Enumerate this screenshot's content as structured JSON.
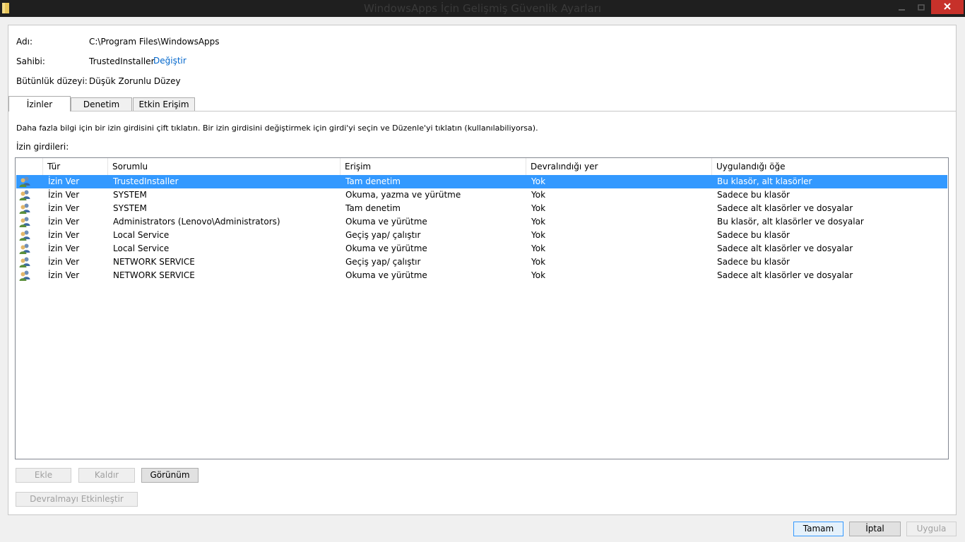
{
  "window": {
    "title": "WindowsApps İçin Gelişmiş Güvenlik Ayarları"
  },
  "info": {
    "name_label": "Adı:",
    "name_value": "C:\\Program Files\\WindowsApps",
    "owner_label": "Sahibi:",
    "owner_value": "TrustedInstaller",
    "owner_change_link": "Değiştir",
    "integrity_label": "Bütünlük düzeyi:",
    "integrity_value": "Düşük Zorunlu Düzey"
  },
  "tabs": [
    {
      "label": "İzinler",
      "active": true
    },
    {
      "label": "Denetim",
      "active": false
    },
    {
      "label": "Etkin Erişim",
      "active": false
    }
  ],
  "description": "Daha fazla bilgi için bir izin girdisini çift tıklatın. Bir izin girdisini değiştirmek için girdi'yi seçin ve Düzenle'yi tıklatın (kullanılabiliyorsa).",
  "list_label": "İzin girdileri:",
  "columns": [
    "Tür",
    "Sorumlu",
    "Erişim",
    "Devralındığı yer",
    "Uygulandığı öğe"
  ],
  "entries": [
    {
      "type": "İzin Ver",
      "principal": "TrustedInstaller",
      "access": "Tam denetim",
      "inherited": "Yok",
      "applies": "Bu klasör, alt klasörler"
    },
    {
      "type": "İzin Ver",
      "principal": "SYSTEM",
      "access": "Okuma, yazma ve yürütme",
      "inherited": "Yok",
      "applies": "Sadece bu klasör"
    },
    {
      "type": "İzin Ver",
      "principal": "SYSTEM",
      "access": "Tam denetim",
      "inherited": "Yok",
      "applies": "Sadece alt klasörler ve dosyalar"
    },
    {
      "type": "İzin Ver",
      "principal": "Administrators (Lenovo\\Administrators)",
      "access": "Okuma ve yürütme",
      "inherited": "Yok",
      "applies": "Bu klasör, alt klasörler ve dosyalar"
    },
    {
      "type": "İzin Ver",
      "principal": "Local Service",
      "access": "Geçiş yap/ çalıştır",
      "inherited": "Yok",
      "applies": "Sadece bu klasör"
    },
    {
      "type": "İzin Ver",
      "principal": "Local Service",
      "access": "Okuma ve yürütme",
      "inherited": "Yok",
      "applies": "Sadece alt klasörler ve dosyalar"
    },
    {
      "type": "İzin Ver",
      "principal": "NETWORK SERVICE",
      "access": "Geçiş yap/ çalıştır",
      "inherited": "Yok",
      "applies": "Sadece bu klasör"
    },
    {
      "type": "İzin Ver",
      "principal": "NETWORK SERVICE",
      "access": "Okuma ve yürütme",
      "inherited": "Yok",
      "applies": "Sadece alt klasörler ve dosyalar"
    }
  ],
  "selected_index": 0,
  "buttons": {
    "add": "Ekle",
    "remove": "Kaldır",
    "view": "Görünüm",
    "enable_inheritance": "Devralmayı Etkinleştir",
    "ok": "Tamam",
    "cancel": "İptal",
    "apply": "Uygula"
  },
  "icons": {
    "window": "folder-icon",
    "entry": "user-group-icon"
  },
  "colors": {
    "selection": "#3399ff",
    "link": "#0066cc",
    "close": "#c7312a",
    "titlebar": "#1f1f1f"
  }
}
